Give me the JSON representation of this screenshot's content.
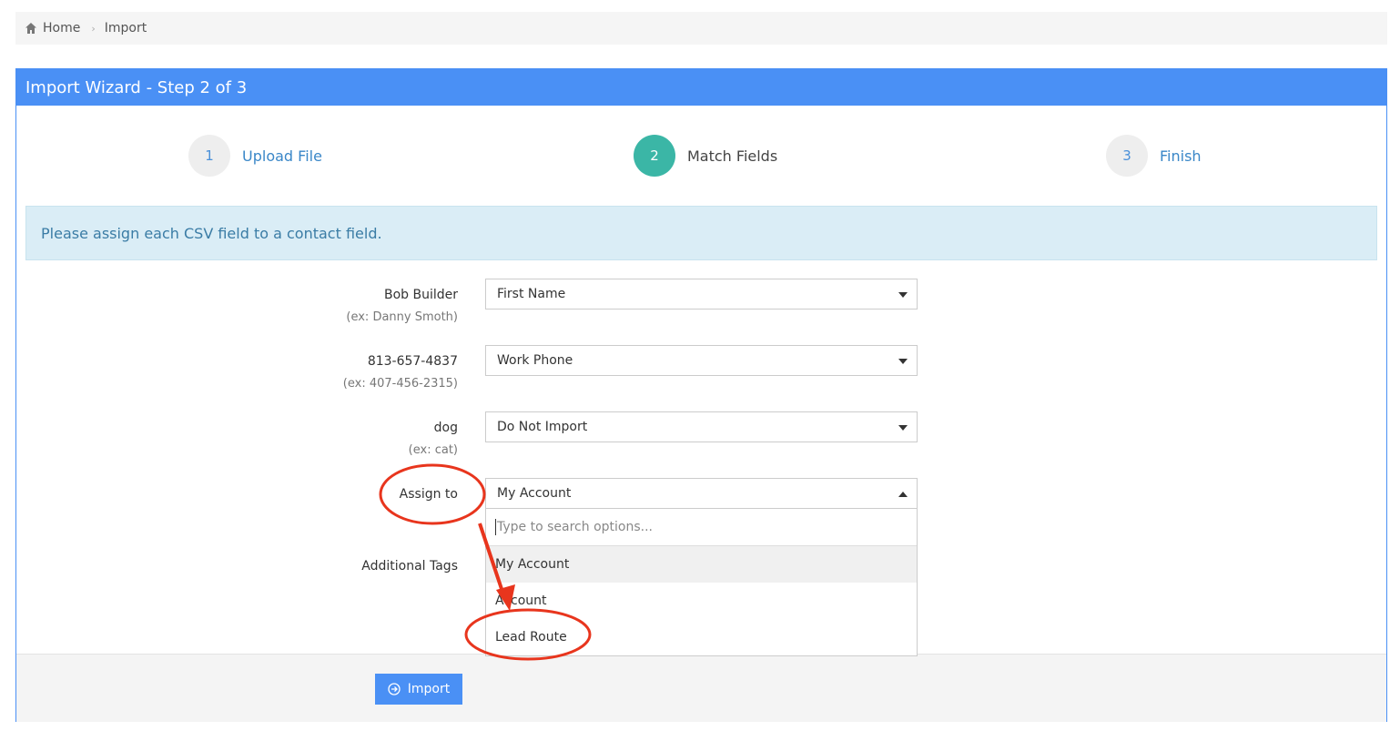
{
  "breadcrumb": {
    "home": "Home",
    "current": "Import"
  },
  "panel": {
    "title": "Import Wizard - Step 2 of 3"
  },
  "steps": [
    {
      "num": "1",
      "label": "Upload File"
    },
    {
      "num": "2",
      "label": "Match Fields"
    },
    {
      "num": "3",
      "label": "Finish"
    }
  ],
  "alert": "Please assign each CSV field to a contact field.",
  "fields": [
    {
      "label": "Bob Builder",
      "hint": "(ex: Danny Smoth)",
      "value": "First Name"
    },
    {
      "label": "813-657-4837",
      "hint": "(ex: 407-456-2315)",
      "value": "Work Phone"
    },
    {
      "label": "dog",
      "hint": "(ex: cat)",
      "value": "Do Not Import"
    }
  ],
  "assign": {
    "label": "Assign to",
    "value": "My Account",
    "search_placeholder": "Type to search options...",
    "options": [
      "My Account",
      "Account",
      "Lead Route"
    ]
  },
  "tags": {
    "label": "Additional Tags"
  },
  "footer": {
    "import_label": "Import"
  },
  "colors": {
    "brand": "#4a90f5",
    "active_step": "#3bb6a6",
    "annotation": "#e8351d"
  }
}
